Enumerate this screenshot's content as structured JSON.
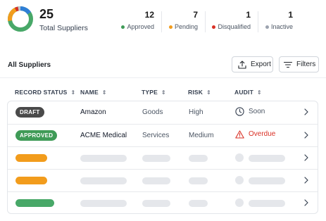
{
  "summary": {
    "total": "25",
    "total_label": "Total Suppliers",
    "stats": [
      {
        "count": "12",
        "label": "Approved",
        "color": "#3f9b57"
      },
      {
        "count": "7",
        "label": "Pending",
        "color": "#f29c1c"
      },
      {
        "count": "1",
        "label": "Disqualified",
        "color": "#d93025"
      },
      {
        "count": "1",
        "label": "Inactive",
        "color": "#9ca3af"
      }
    ],
    "donut_colors": [
      "#48a868",
      "#f29c1c",
      "#d93025",
      "#bfc4ca",
      "#2f7fd6"
    ]
  },
  "toolbar": {
    "title": "All Suppliers",
    "export_label": "Export",
    "filters_label": "Filters"
  },
  "table": {
    "columns": [
      {
        "label": "RECORD STATUS"
      },
      {
        "label": "NAME"
      },
      {
        "label": "TYPE"
      },
      {
        "label": "RISK"
      },
      {
        "label": "AUDIT"
      }
    ],
    "rows": [
      {
        "status": "DRAFT",
        "name": "Amazon",
        "type": "Goods",
        "risk": "High",
        "audit": "Soon",
        "audit_icon": "clock-icon"
      },
      {
        "status": "APPROVED",
        "name": "ACME Medical",
        "type": "Services",
        "risk": "Medium",
        "audit": "Overdue",
        "audit_icon": "warning-icon"
      }
    ],
    "placeholder_rows": [
      {
        "status_color": "orange"
      },
      {
        "status_color": "orange"
      },
      {
        "status_color": "green"
      }
    ]
  }
}
